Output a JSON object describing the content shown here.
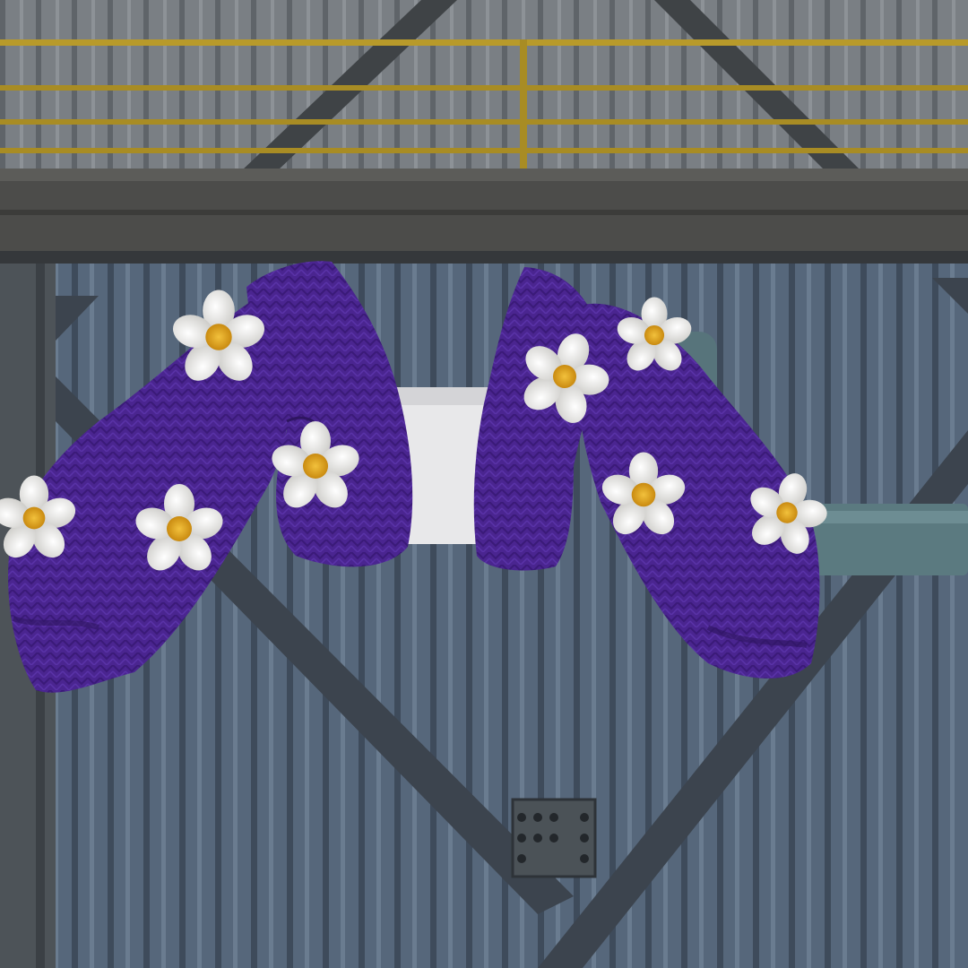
{
  "scene": {
    "subject": "purple-knit-cropped-cardigan",
    "background": "industrial-warehouse-wall",
    "colors": {
      "wall_upper": "#7d8286",
      "wall_lower": "#55657a",
      "beam": "#4a4a48",
      "railing": "#b89a2a",
      "truss": "#3e4650",
      "pipe": "#5b7a80",
      "knit_purple": "#4a2590",
      "knit_purple_shadow": "#2e1560",
      "inner_top": "#e8e8ea",
      "petal": "#e9e8e4",
      "flower_center": "#e0a51c"
    },
    "icons": {
      "flower": "daisy-appliqué"
    }
  }
}
